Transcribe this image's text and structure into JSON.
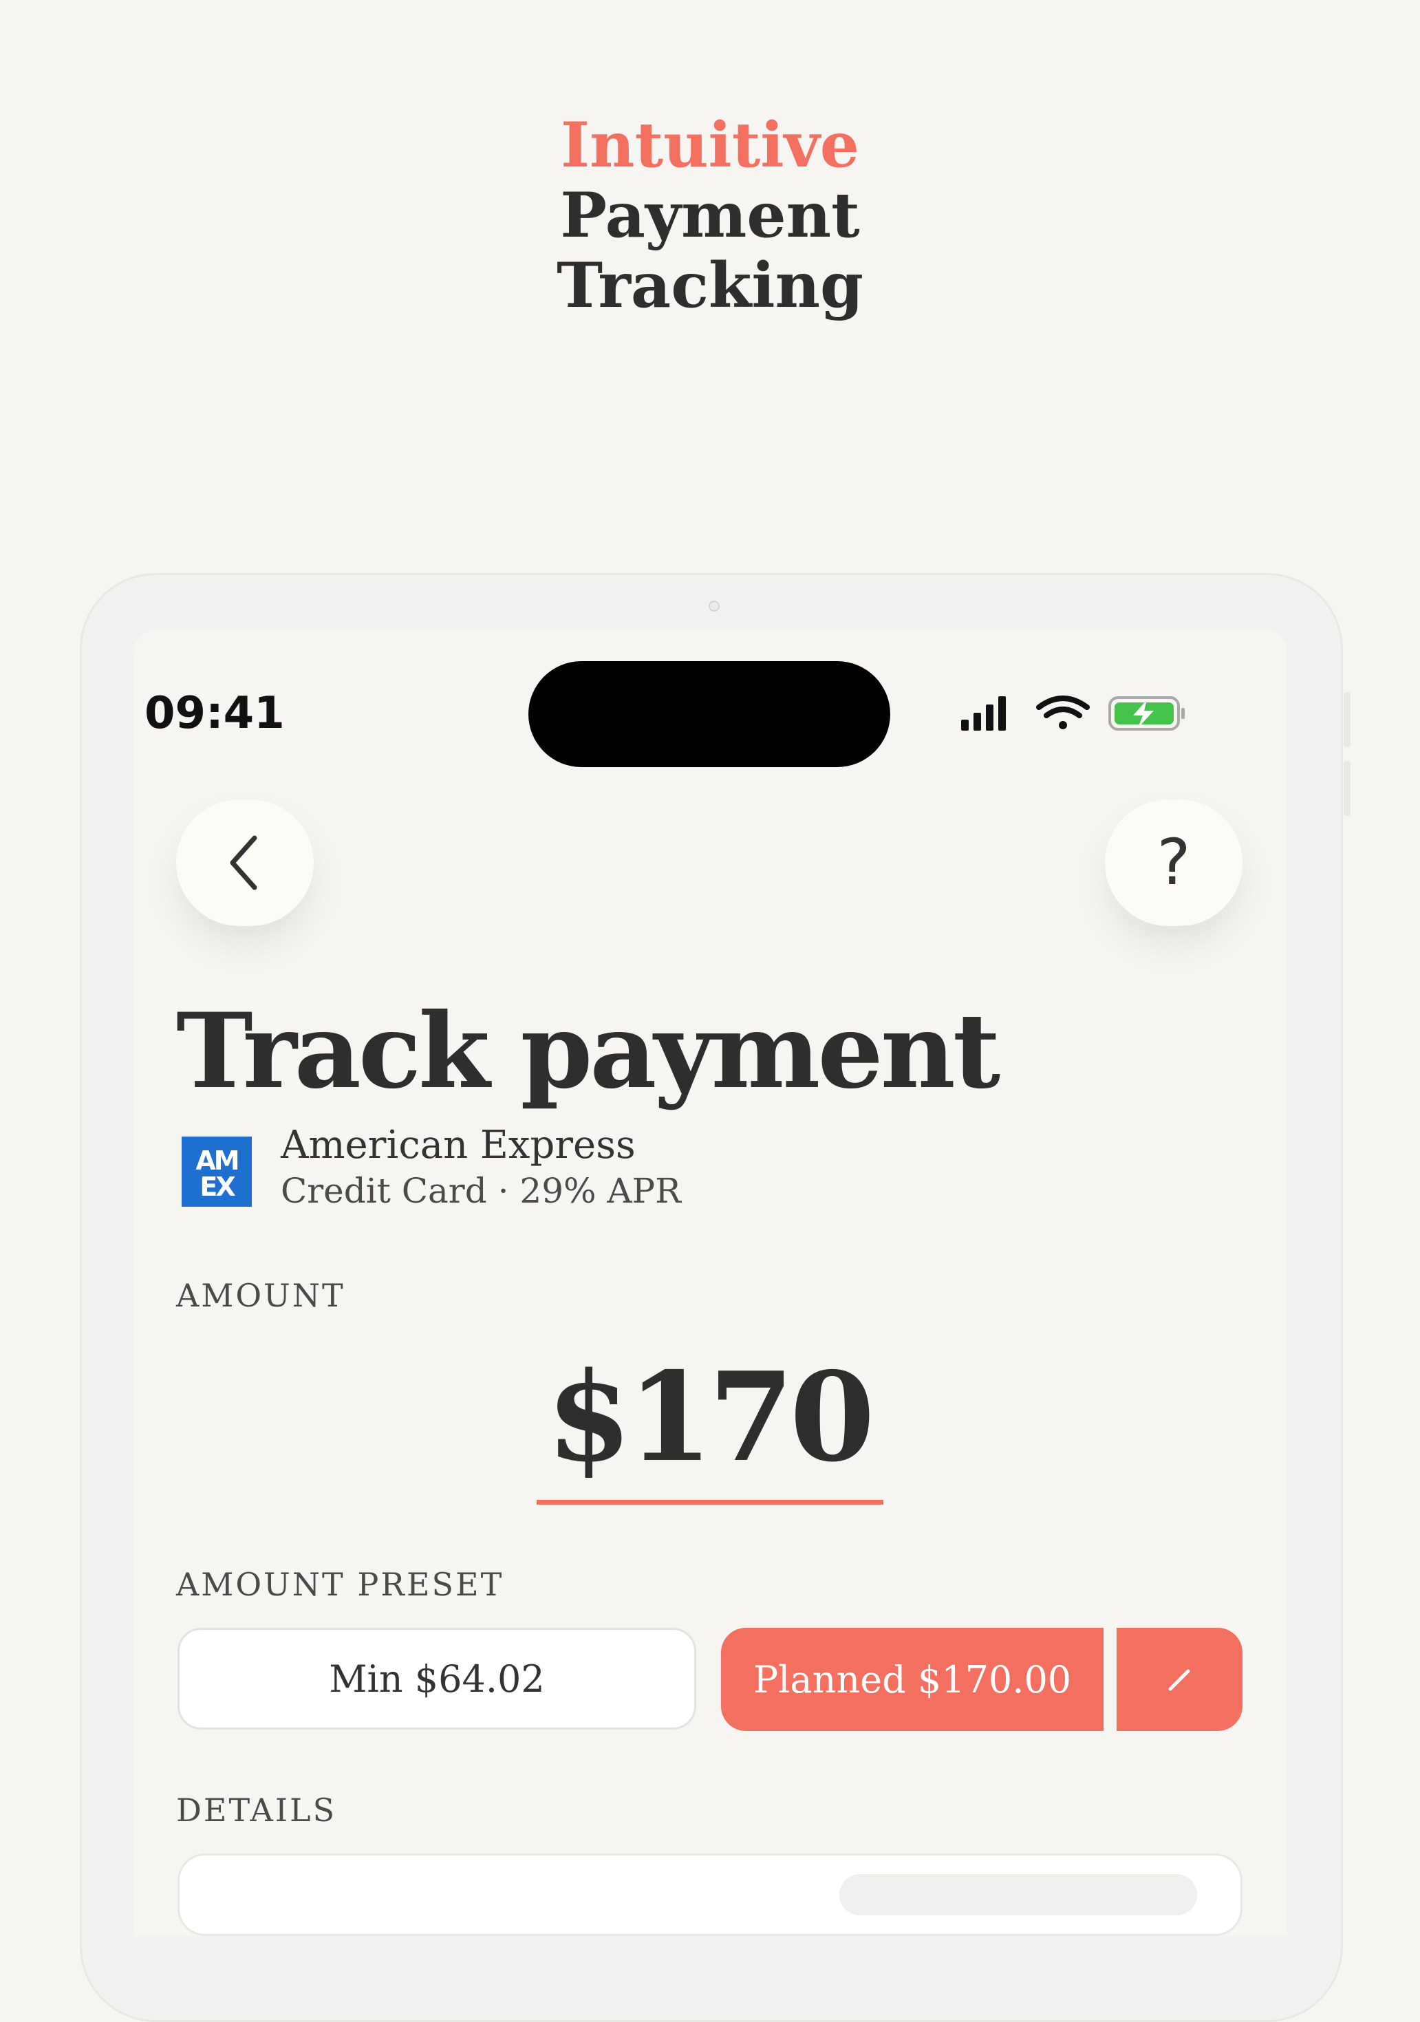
{
  "headline": {
    "accent": "Intuitive",
    "line2": "Payment",
    "line3": "Tracking"
  },
  "status_bar": {
    "time": "09:41",
    "icons": [
      "cellular-signal-icon",
      "wifi-icon",
      "battery-charging-icon"
    ]
  },
  "nav": {
    "back_icon": "chevron-left-icon",
    "help_label": "?"
  },
  "page": {
    "title": "Track payment"
  },
  "card": {
    "logo_text": "AMEX",
    "name": "American Express",
    "subtitle": "Credit Card · 29% APR"
  },
  "amount": {
    "label": "AMOUNT",
    "value": "$170"
  },
  "preset": {
    "label": "AMOUNT PRESET",
    "min_label": "Min $64.02",
    "planned_label": "Planned $170.00",
    "edit_icon": "pencil-icon"
  },
  "details": {
    "label": "DETAILS"
  },
  "colors": {
    "accent": "#f36f60",
    "background": "#f6f5f1",
    "text": "#2e2e2e",
    "amex_blue": "#1f6fd1",
    "battery_green": "#44c24a"
  }
}
